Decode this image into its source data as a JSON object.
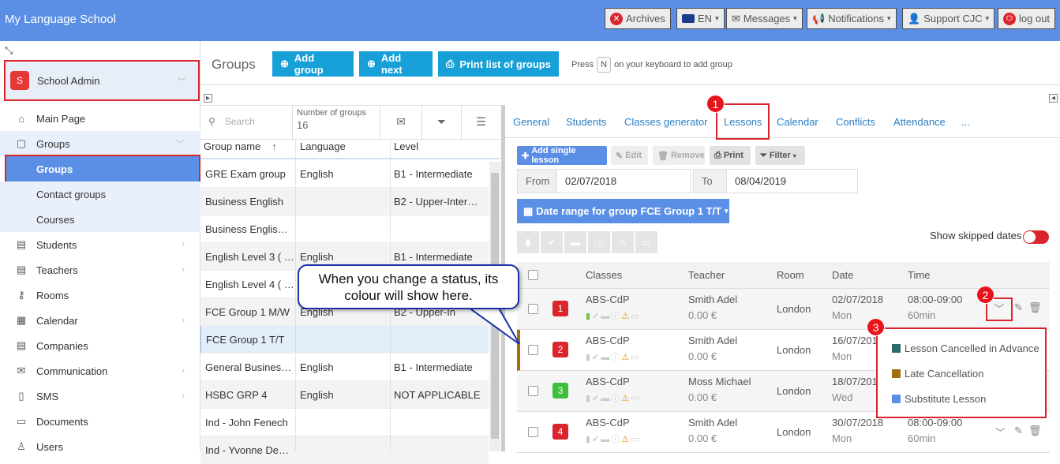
{
  "app_title": "My Language School",
  "topnav": {
    "archives": "Archives",
    "lang": "EN",
    "messages": "Messages",
    "notifications": "Notifications",
    "support": "Support CJC",
    "logout": "log out"
  },
  "sidebar": {
    "school_badge": "S",
    "school_name": "School Admin",
    "items": [
      {
        "label": "Main Page",
        "icon": "home-icon"
      },
      {
        "label": "Groups",
        "icon": "cube-icon"
      },
      {
        "label": "Groups",
        "sub": true,
        "active": true
      },
      {
        "label": "Contact groups",
        "sub": true
      },
      {
        "label": "Courses",
        "sub": true
      },
      {
        "label": "Students",
        "icon": "id-card-icon"
      },
      {
        "label": "Teachers",
        "icon": "id-card-icon"
      },
      {
        "label": "Rooms",
        "icon": "key-icon"
      },
      {
        "label": "Calendar",
        "icon": "calendar-icon"
      },
      {
        "label": "Companies",
        "icon": "id-card-icon"
      },
      {
        "label": "Communication",
        "icon": "envelope-icon"
      },
      {
        "label": "SMS",
        "icon": "mobile-icon"
      },
      {
        "label": "Documents",
        "icon": "folder-icon"
      },
      {
        "label": "Users",
        "icon": "user-icon"
      }
    ]
  },
  "header": {
    "title": "Groups",
    "add_group": "Add group",
    "add_next": "Add next",
    "print_list": "Print list of groups",
    "press": "Press",
    "key": "N",
    "hint": "on your keyboard to add group"
  },
  "list": {
    "search_placeholder": "Search",
    "number_label": "Number of groups",
    "number_value": "16",
    "columns": [
      "Group name",
      "Language",
      "Level"
    ],
    "rows": [
      [
        "GRE Exam group",
        "English",
        "B1 - Intermediate"
      ],
      [
        "Business English",
        "",
        "B2 - Upper-Inter…"
      ],
      [
        "Business Englis…",
        "",
        ""
      ],
      [
        "English Level 3 ( …",
        "English",
        "B1 - Intermediate"
      ],
      [
        "English Level 4 ( …",
        "",
        ""
      ],
      [
        "FCE Group 1 M/W",
        "English",
        "B2 - Upper-In"
      ],
      [
        "FCE Group 1 T/T",
        "",
        ""
      ],
      [
        "General Busines…",
        "English",
        "B1 - Intermediate"
      ],
      [
        "HSBC GRP 4",
        "English",
        "NOT APPLICABLE"
      ],
      [
        "Ind - John Fenech",
        "",
        ""
      ],
      [
        "Ind - Yvonne De…",
        "",
        ""
      ]
    ]
  },
  "tabs": [
    "General",
    "Students",
    "Classes generator",
    "Lessons",
    "Calendar",
    "Conflicts",
    "Attendance",
    "..."
  ],
  "lesson_toolbar": {
    "add": "Add single lesson",
    "edit": "Edit",
    "remove": "Remove",
    "print": "Print",
    "filter": "Filter"
  },
  "dates": {
    "from_label": "From",
    "from_value": "02/07/2018",
    "to_label": "To",
    "to_value": "08/04/2019",
    "range_btn": "Date range for group FCE Group 1 T/T"
  },
  "show_skipped": "Show skipped dates",
  "lesson_columns": [
    "Classes",
    "Teacher",
    "Room",
    "Date",
    "Time"
  ],
  "lessons": [
    {
      "num": "1",
      "color": "#d9252b",
      "cls": "ABS-CdP",
      "teacher": "Smith Adel",
      "price": "0.00 €",
      "room": "London",
      "date": "02/07/2018",
      "day": "Mon",
      "time": "08:00-09:00",
      "dur": "60min"
    },
    {
      "num": "2",
      "color": "#d9252b",
      "cls": "ABS-CdP",
      "teacher": "Smith Adel",
      "price": "0.00 €",
      "room": "London",
      "date": "16/07/2018",
      "day": "Mon",
      "time": "",
      "dur": ""
    },
    {
      "num": "3",
      "color": "#3ec03e",
      "cls": "ABS-CdP",
      "teacher": "Moss Michael",
      "price": "0.00 €",
      "room": "London",
      "date": "18/07/2018",
      "day": "Wed",
      "time": "",
      "dur": ""
    },
    {
      "num": "4",
      "color": "#d9252b",
      "cls": "ABS-CdP",
      "teacher": "Smith Adel",
      "price": "0.00 €",
      "room": "London",
      "date": "30/07/2018",
      "day": "Mon",
      "time": "08:00-09:00",
      "dur": "60min"
    }
  ],
  "status_menu": [
    {
      "label": "Lesson Cancelled in Advance",
      "color": "#2e6b6b"
    },
    {
      "label": "Late Cancellation",
      "color": "#a0700e"
    },
    {
      "label": "Substitute Lesson",
      "color": "#5b8fe6"
    }
  ],
  "markers": [
    "1",
    "2",
    "3"
  ],
  "callout": "When you change a status, its colour will show here."
}
